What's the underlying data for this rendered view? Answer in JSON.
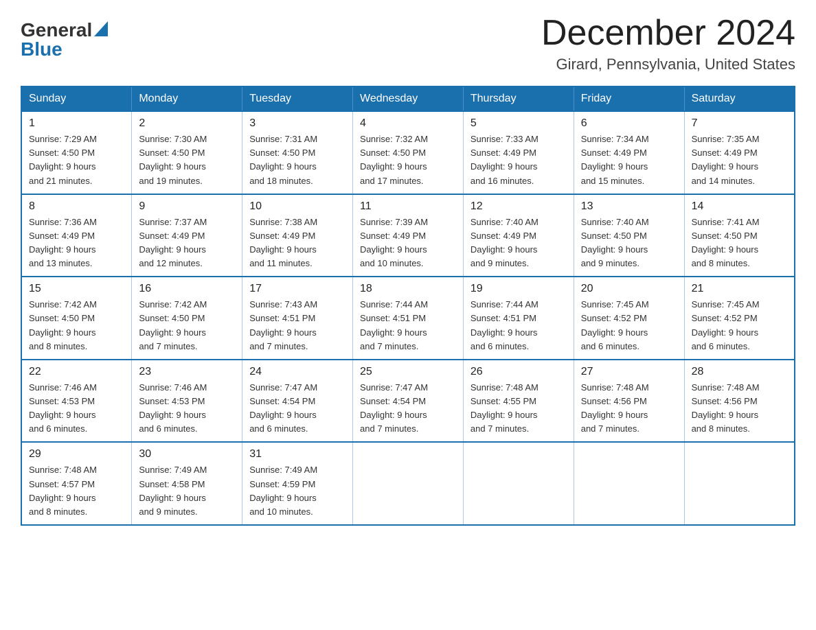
{
  "header": {
    "logo_general": "General",
    "logo_blue": "Blue",
    "title": "December 2024",
    "location": "Girard, Pennsylvania, United States"
  },
  "calendar": {
    "days_of_week": [
      "Sunday",
      "Monday",
      "Tuesday",
      "Wednesday",
      "Thursday",
      "Friday",
      "Saturday"
    ],
    "weeks": [
      [
        {
          "day": "1",
          "sunrise": "7:29 AM",
          "sunset": "4:50 PM",
          "daylight": "9 hours and 21 minutes."
        },
        {
          "day": "2",
          "sunrise": "7:30 AM",
          "sunset": "4:50 PM",
          "daylight": "9 hours and 19 minutes."
        },
        {
          "day": "3",
          "sunrise": "7:31 AM",
          "sunset": "4:50 PM",
          "daylight": "9 hours and 18 minutes."
        },
        {
          "day": "4",
          "sunrise": "7:32 AM",
          "sunset": "4:50 PM",
          "daylight": "9 hours and 17 minutes."
        },
        {
          "day": "5",
          "sunrise": "7:33 AM",
          "sunset": "4:49 PM",
          "daylight": "9 hours and 16 minutes."
        },
        {
          "day": "6",
          "sunrise": "7:34 AM",
          "sunset": "4:49 PM",
          "daylight": "9 hours and 15 minutes."
        },
        {
          "day": "7",
          "sunrise": "7:35 AM",
          "sunset": "4:49 PM",
          "daylight": "9 hours and 14 minutes."
        }
      ],
      [
        {
          "day": "8",
          "sunrise": "7:36 AM",
          "sunset": "4:49 PM",
          "daylight": "9 hours and 13 minutes."
        },
        {
          "day": "9",
          "sunrise": "7:37 AM",
          "sunset": "4:49 PM",
          "daylight": "9 hours and 12 minutes."
        },
        {
          "day": "10",
          "sunrise": "7:38 AM",
          "sunset": "4:49 PM",
          "daylight": "9 hours and 11 minutes."
        },
        {
          "day": "11",
          "sunrise": "7:39 AM",
          "sunset": "4:49 PM",
          "daylight": "9 hours and 10 minutes."
        },
        {
          "day": "12",
          "sunrise": "7:40 AM",
          "sunset": "4:49 PM",
          "daylight": "9 hours and 9 minutes."
        },
        {
          "day": "13",
          "sunrise": "7:40 AM",
          "sunset": "4:50 PM",
          "daylight": "9 hours and 9 minutes."
        },
        {
          "day": "14",
          "sunrise": "7:41 AM",
          "sunset": "4:50 PM",
          "daylight": "9 hours and 8 minutes."
        }
      ],
      [
        {
          "day": "15",
          "sunrise": "7:42 AM",
          "sunset": "4:50 PM",
          "daylight": "9 hours and 8 minutes."
        },
        {
          "day": "16",
          "sunrise": "7:42 AM",
          "sunset": "4:50 PM",
          "daylight": "9 hours and 7 minutes."
        },
        {
          "day": "17",
          "sunrise": "7:43 AM",
          "sunset": "4:51 PM",
          "daylight": "9 hours and 7 minutes."
        },
        {
          "day": "18",
          "sunrise": "7:44 AM",
          "sunset": "4:51 PM",
          "daylight": "9 hours and 7 minutes."
        },
        {
          "day": "19",
          "sunrise": "7:44 AM",
          "sunset": "4:51 PM",
          "daylight": "9 hours and 6 minutes."
        },
        {
          "day": "20",
          "sunrise": "7:45 AM",
          "sunset": "4:52 PM",
          "daylight": "9 hours and 6 minutes."
        },
        {
          "day": "21",
          "sunrise": "7:45 AM",
          "sunset": "4:52 PM",
          "daylight": "9 hours and 6 minutes."
        }
      ],
      [
        {
          "day": "22",
          "sunrise": "7:46 AM",
          "sunset": "4:53 PM",
          "daylight": "9 hours and 6 minutes."
        },
        {
          "day": "23",
          "sunrise": "7:46 AM",
          "sunset": "4:53 PM",
          "daylight": "9 hours and 6 minutes."
        },
        {
          "day": "24",
          "sunrise": "7:47 AM",
          "sunset": "4:54 PM",
          "daylight": "9 hours and 6 minutes."
        },
        {
          "day": "25",
          "sunrise": "7:47 AM",
          "sunset": "4:54 PM",
          "daylight": "9 hours and 7 minutes."
        },
        {
          "day": "26",
          "sunrise": "7:48 AM",
          "sunset": "4:55 PM",
          "daylight": "9 hours and 7 minutes."
        },
        {
          "day": "27",
          "sunrise": "7:48 AM",
          "sunset": "4:56 PM",
          "daylight": "9 hours and 7 minutes."
        },
        {
          "day": "28",
          "sunrise": "7:48 AM",
          "sunset": "4:56 PM",
          "daylight": "9 hours and 8 minutes."
        }
      ],
      [
        {
          "day": "29",
          "sunrise": "7:48 AM",
          "sunset": "4:57 PM",
          "daylight": "9 hours and 8 minutes."
        },
        {
          "day": "30",
          "sunrise": "7:49 AM",
          "sunset": "4:58 PM",
          "daylight": "9 hours and 9 minutes."
        },
        {
          "day": "31",
          "sunrise": "7:49 AM",
          "sunset": "4:59 PM",
          "daylight": "9 hours and 10 minutes."
        },
        null,
        null,
        null,
        null
      ]
    ],
    "labels": {
      "sunrise": "Sunrise:",
      "sunset": "Sunset:",
      "daylight": "Daylight:"
    }
  }
}
